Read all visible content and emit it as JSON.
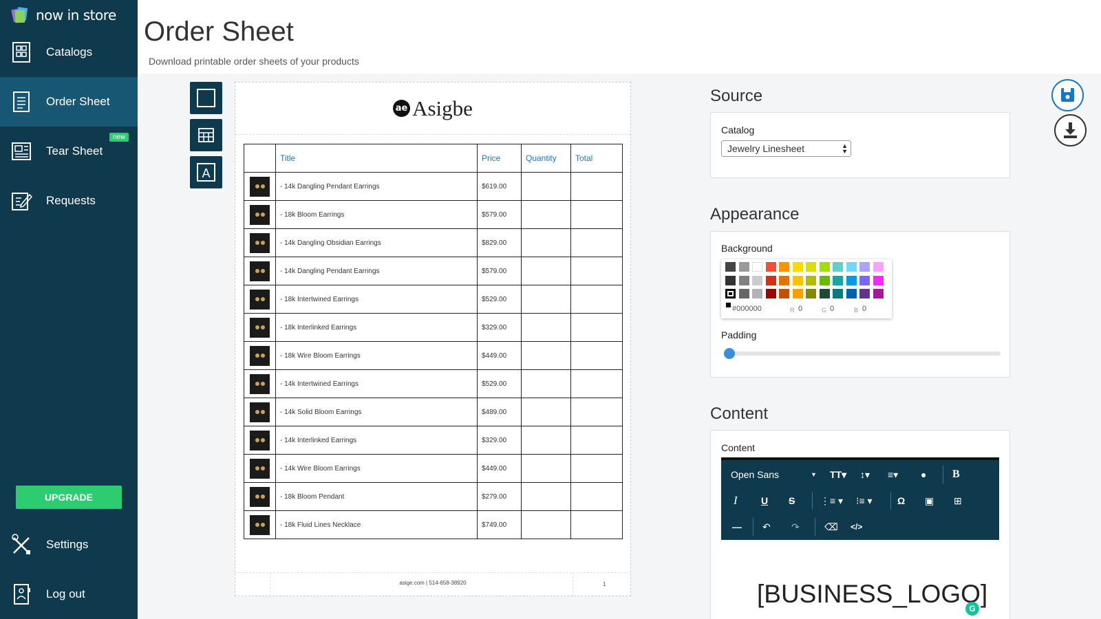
{
  "app": {
    "logo_text": "now in store"
  },
  "sidebar": {
    "items": [
      {
        "label": "Catalogs",
        "icon": "catalog-icon"
      },
      {
        "label": "Order Sheet",
        "icon": "order-sheet-icon",
        "active": true
      },
      {
        "label": "Tear Sheet",
        "icon": "tear-sheet-icon",
        "badge": "new"
      },
      {
        "label": "Requests",
        "icon": "requests-icon"
      }
    ],
    "upgrade_label": "UPGRADE",
    "settings_label": "Settings",
    "logout_label": "Log out"
  },
  "header": {
    "title": "Order Sheet",
    "subtitle": "Download printable order sheets of your products"
  },
  "tools": [
    "blank-block-icon",
    "table-block-icon",
    "text-block-icon"
  ],
  "sheet": {
    "brand_mark": "ae",
    "brand_name": "Asigbe",
    "columns": [
      "Title",
      "Price",
      "Quantity",
      "Total"
    ],
    "rows": [
      {
        "title": "- 14k Dangling Pendant Earrings",
        "price": "$619.00"
      },
      {
        "title": "- 18k Bloom Earrings",
        "price": "$579.00"
      },
      {
        "title": "- 14k Dangling Obsidian Earrings",
        "price": "$829.00"
      },
      {
        "title": "- 14k Dangling Pendant Earrings",
        "price": "$579.00"
      },
      {
        "title": "- 18k Intertwined Earrings",
        "price": "$529.00"
      },
      {
        "title": "- 18k Interlinked Earrings",
        "price": "$329.00"
      },
      {
        "title": "- 18k Wire Bloom Earrings",
        "price": "$449.00"
      },
      {
        "title": "- 14k Intertwined Earrings",
        "price": "$529.00"
      },
      {
        "title": "- 14k Solid Bloom Earrings",
        "price": "$489.00"
      },
      {
        "title": "- 14k Interlinked Earrings",
        "price": "$329.00"
      },
      {
        "title": "- 14k Wire Bloom Earrings",
        "price": "$449.00"
      },
      {
        "title": "- 18k Bloom Pendant",
        "price": "$279.00"
      },
      {
        "title": "- 18k Fluid Lines Necklace",
        "price": "$749.00"
      }
    ],
    "footer_text": "asige.com | 514-658-38920",
    "page_number": "1"
  },
  "source": {
    "title": "Source",
    "catalog_label": "Catalog",
    "catalog_value": "Jewelry Linesheet"
  },
  "appearance": {
    "title": "Appearance",
    "background_label": "Background",
    "padding_label": "Padding",
    "padding_value": 0,
    "swatch_rows": [
      [
        "#444444",
        "#999999",
        "#ffffff",
        "#f44e3b",
        "#fe9200",
        "#fcdc00",
        "#dbdf00",
        "#a4dd00",
        "#68ccca",
        "#73d8ff",
        "#aea1ff",
        "#fda1ff"
      ],
      [
        "#333333",
        "#808080",
        "#cccccc",
        "#d33115",
        "#e27300",
        "#fcc400",
        "#b0bc00",
        "#68bc00",
        "#16a5a5",
        "#009ce0",
        "#7b64ff",
        "#fa28ff"
      ],
      [
        "#000000",
        "#666666",
        "#b3b3b3",
        "#9f0500",
        "#c45100",
        "#fb9e00",
        "#808900",
        "#194d33",
        "#0c797d",
        "#0062b1",
        "#653294",
        "#ab149e"
      ]
    ],
    "hex": "#000000",
    "r": "0",
    "g": "0",
    "b": "0",
    "r_label": "R",
    "g_label": "G",
    "b_label": "B"
  },
  "content": {
    "title": "Content",
    "content_label": "Content",
    "font_family": "Open Sans",
    "editor_text": "[BUSINESS_LOGO]"
  },
  "colors": {
    "sidebar": "#0f3a4e",
    "active": "#175773",
    "accent": "#2ecc71",
    "link": "#1a75c4"
  }
}
